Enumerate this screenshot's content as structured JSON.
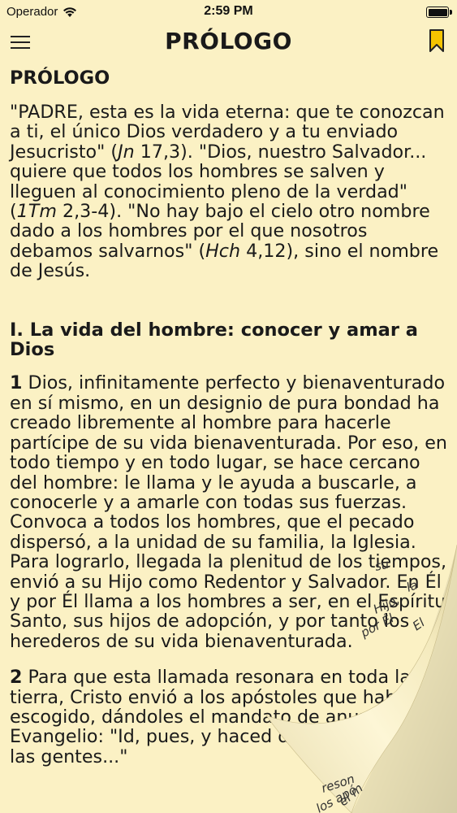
{
  "status": {
    "carrier": "Operador",
    "time": "2:59 PM"
  },
  "nav": {
    "title": "PRÓLOGO"
  },
  "article": {
    "heading": "PRÓLOGO",
    "intro": [
      "\"PADRE, esta es la vida eterna: que te conozcan a ti, el único Dios verdadero y a tu enviado Jesucristo\" (",
      "Jn",
      " 17,3). \"Dios, nuestro Salvador... quiere que todos los hombres se salven y lleguen al conocimiento pleno de la verdad\" (",
      "1Tm",
      " 2,3-4). \"No hay bajo el cielo otro nombre dado a los hombres por el que nosotros debamos salvarnos\" (",
      "Hch",
      " 4,12), sino el nombre de Jesús."
    ],
    "section_title": "I. La vida del hombre: conocer y amar a Dios",
    "para1_number": "1",
    "para1_text": " Dios, infinitamente perfecto y bienaventurado en sí mismo, en un designio de pura bondad ha creado libremente al hombre para hacerle partícipe de su vida bienaventurada. Por eso, en todo tiempo y en todo lugar, se hace cercano del hombre: le llama y le ayuda a buscarle, a conocerle y a amarle con todas sus fuerzas. Convoca a todos los hombres, que el pecado dispersó, a la unidad de su familia, la Iglesia. Para lograrlo, llegada la plenitud de los tiempos, envió a su Hijo como Redentor y Salvador. En Él y por Él llama a los hombres a ser, en el Espíritu Santo, sus hijos de adopción, y por tanto los herederos de su vida bienaventurada.",
    "para2_number": "2",
    "para2_text": " Para que esta llamada resonara en toda la tierra, Cristo envió a los apóstoles que había escogido, dándoles el mandato de anunciar el Evangelio: \"Id, pues, y haced discípulos a todas las gentes...\"",
    "curl_words": [
      "su",
      "la",
      "Hijo,",
      "por Él",
      "El",
      "reson",
      "los apó",
      "el m"
    ]
  }
}
